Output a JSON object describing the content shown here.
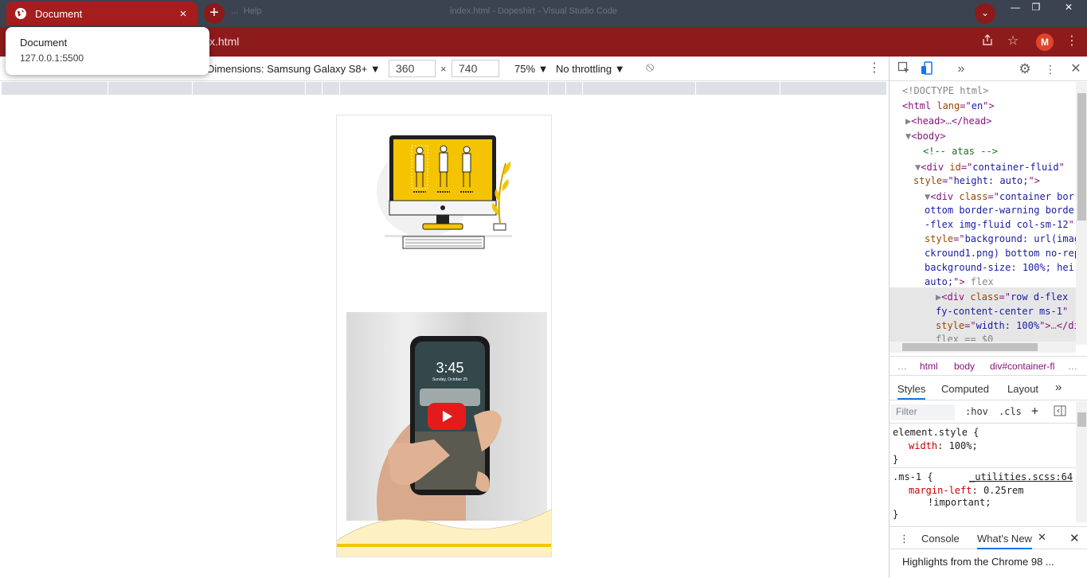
{
  "browser": {
    "tab_title": "Document",
    "tab_close": "×",
    "new_tab": "+",
    "blurred_titles": [
      "...",
      "Help",
      "index.html - Dopeshirt - Visual Studio Code"
    ],
    "profile_dropdown": "⌄",
    "window_buttons": [
      "—",
      "❐",
      "✕"
    ],
    "url": "x.html",
    "avatar_letter": "M",
    "accent_color": "#8e1b1b"
  },
  "popup": {
    "title": "Document",
    "url": "127.0.0.1:5500"
  },
  "device_toolbar": {
    "dimensions_label": "Dimensions: Samsung Galaxy S8+ ▼",
    "width": "360",
    "height": "740",
    "x": "×",
    "zoom": "75% ▼",
    "throttling": "No throttling ▼",
    "more": "⋮"
  },
  "page": {
    "video_time": "3:45",
    "video_date": "Sunday, October 25"
  },
  "devtools": {
    "elements": [
      {
        "text_parts": [
          {
            "c": "gray",
            "t": "<!DOCTYPE html>"
          }
        ]
      },
      {
        "text_parts": [
          {
            "c": "tag",
            "t": "<html "
          },
          {
            "c": "attr",
            "t": "lang"
          },
          {
            "c": "tag",
            "t": "=\""
          },
          {
            "c": "val",
            "t": "en"
          },
          {
            "c": "tag",
            "t": "\">"
          }
        ]
      },
      {
        "text_parts": [
          {
            "c": "gray",
            "t": "▶"
          },
          {
            "c": "tag",
            "t": "<head>"
          },
          {
            "c": "gray",
            "t": "…"
          },
          {
            "c": "tag",
            "t": "</head>"
          }
        ]
      },
      {
        "text_parts": [
          {
            "c": "gray",
            "t": "▼"
          },
          {
            "c": "tag",
            "t": "<body>"
          }
        ]
      },
      {
        "text_parts": [
          {
            "c": "cmt",
            "t": "<!-- atas -->"
          }
        ]
      },
      {
        "text_parts": [
          {
            "c": "gray",
            "t": "▼"
          },
          {
            "c": "tag",
            "t": "<div "
          },
          {
            "c": "attr",
            "t": "id"
          },
          {
            "c": "tag",
            "t": "=\""
          },
          {
            "c": "val",
            "t": "container-fluid"
          },
          {
            "c": "tag",
            "t": "\""
          }
        ]
      },
      {
        "text_parts": [
          {
            "c": "attr",
            "t": "style"
          },
          {
            "c": "tag",
            "t": "=\""
          },
          {
            "c": "val",
            "t": "height: auto;"
          },
          {
            "c": "tag",
            "t": "\">"
          }
        ]
      },
      {
        "text_parts": [
          {
            "c": "gray",
            "t": "▼"
          },
          {
            "c": "tag",
            "t": "<div "
          },
          {
            "c": "attr",
            "t": "class"
          },
          {
            "c": "tag",
            "t": "=\""
          },
          {
            "c": "val",
            "t": "container bor"
          }
        ]
      },
      {
        "text_parts": [
          {
            "c": "val",
            "t": "ottom border-warning borde"
          }
        ]
      },
      {
        "text_parts": [
          {
            "c": "val",
            "t": "-flex img-fluid col-sm-12"
          },
          {
            "c": "tag",
            "t": "\""
          }
        ]
      },
      {
        "text_parts": [
          {
            "c": "attr",
            "t": "style"
          },
          {
            "c": "tag",
            "t": "=\""
          },
          {
            "c": "val",
            "t": "background: url(imag"
          }
        ]
      },
      {
        "text_parts": [
          {
            "c": "val",
            "t": "ckround1.png) bottom no-rep"
          }
        ]
      },
      {
        "text_parts": [
          {
            "c": "val",
            "t": "background-size: 100%; hei"
          }
        ]
      },
      {
        "text_parts": [
          {
            "c": "val",
            "t": "auto;"
          },
          {
            "c": "tag",
            "t": "\">"
          },
          {
            "c": "gray",
            "t": " flex"
          }
        ]
      },
      {
        "text_parts": [
          {
            "c": "gray",
            "t": "▶"
          },
          {
            "c": "tag",
            "t": "<div "
          },
          {
            "c": "attr",
            "t": "class"
          },
          {
            "c": "tag",
            "t": "=\""
          },
          {
            "c": "val",
            "t": "row d-flex"
          }
        ]
      },
      {
        "text_parts": [
          {
            "c": "val",
            "t": "fy-content-center ms-1"
          },
          {
            "c": "tag",
            "t": "\""
          }
        ]
      },
      {
        "text_parts": [
          {
            "c": "attr",
            "t": "style"
          },
          {
            "c": "tag",
            "t": "=\""
          },
          {
            "c": "val",
            "t": "width: 100%"
          },
          {
            "c": "tag",
            "t": "\">"
          },
          {
            "c": "gray",
            "t": "…"
          },
          {
            "c": "tag",
            "t": "</di"
          }
        ]
      },
      {
        "text_parts": [
          {
            "c": "gray",
            "t": "flex == $0"
          }
        ]
      }
    ],
    "breadcrumbs": [
      "…",
      "html",
      "body",
      "div#container-fl",
      "…"
    ],
    "style_tabs": [
      "Styles",
      "Computed",
      "Layout",
      "»"
    ],
    "filter_placeholder": "Filter",
    "filter_options": [
      ":hov",
      ".cls",
      "+"
    ],
    "rules": {
      "element_style": "element.style {",
      "width_prop": "width",
      "width_val": "100%;",
      "close": "}",
      "ms_selector": ".ms-1 {",
      "ms_source": "_utilities.scss:64",
      "ms_prop": "margin-left",
      "ms_val": "0.25rem",
      "ms_important": "!important;"
    },
    "drawer_tabs": [
      "Console",
      "What's New"
    ],
    "whats_new": "Highlights from the Chrome 98 ..."
  }
}
